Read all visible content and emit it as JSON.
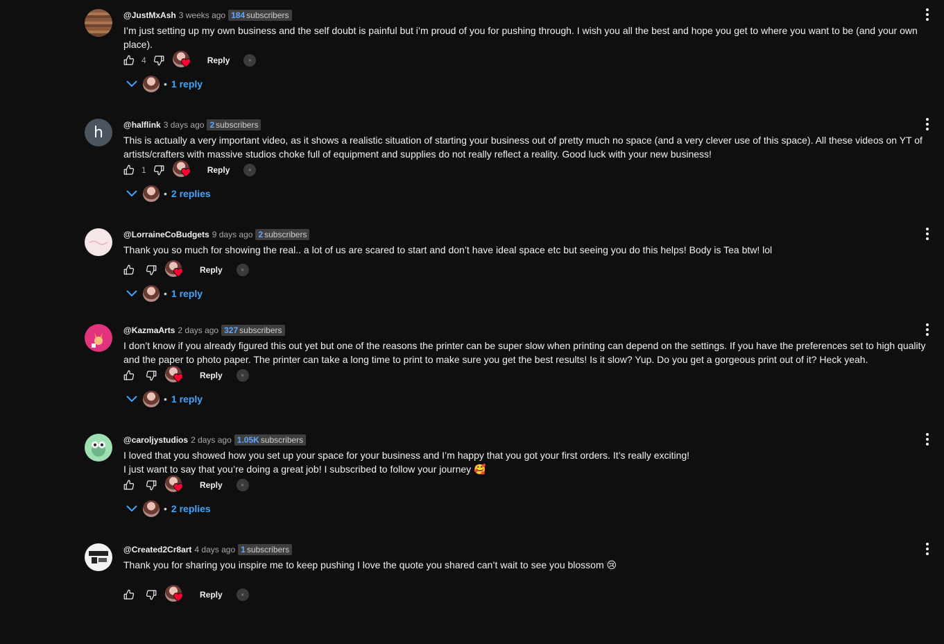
{
  "colors": {
    "background": "#0f0f0f",
    "text": "#f1f1f1",
    "muted": "#aaaaaa",
    "link_blue": "#3ea6ff",
    "badge_bg": "#3f3f3f",
    "heart_red": "#ff0033"
  },
  "comments": [
    {
      "author": "@JustMxAsh",
      "time": "3 weeks ago",
      "subs_count": "184",
      "subs_label": "subscribers",
      "text": "I’m just setting up my own business and the self doubt is painful but i’m proud of you for pushing through. I wish you all the best and hope you get to where you want to be (and your own place).",
      "likes": "4",
      "reply_label": "Reply",
      "replies_label": "1 reply",
      "avatar_type": "wood"
    },
    {
      "author": "@halflink",
      "time": "3 days ago",
      "subs_count": "2",
      "subs_label": "subscribers",
      "text": "This is actually a very important video, as it shows a realistic situation of starting your business out of pretty much no space (and a very clever use of this space). All these videos on YT of artists/crafters with massive studios choke full of equipment and supplies do not really reflect a reality. Good luck with your new business!",
      "likes": "1",
      "reply_label": "Reply",
      "replies_label": "2 replies",
      "avatar_letter": "h",
      "avatar_type": "letter"
    },
    {
      "author": "@LorraineCoBudgets",
      "time": "9 days ago",
      "subs_count": "2",
      "subs_label": "subscribers",
      "text": "Thank you so much for showing the real.. a lot of us are scared to start and don’t have ideal space etc but seeing you do this helps! Body is Tea btw! lol",
      "likes": "",
      "reply_label": "Reply",
      "replies_label": "1 reply",
      "avatar_type": "pink"
    },
    {
      "author": "@KazmaArts",
      "time": "2 days ago",
      "subs_count": "327",
      "subs_label": "subscribers",
      "text": "I don’t know if you already figured this out yet but one of the reasons  the printer can be super slow when printing can depend on the settings. If you have the preferences set to high quality and the paper to photo paper. The printer can take a long time to print to make sure you get the best results! Is it slow? Yup. Do you get a gorgeous print out of it? Heck yeah.",
      "likes": "",
      "reply_label": "Reply",
      "replies_label": "1 reply",
      "avatar_type": "fox"
    },
    {
      "author": "@caroljystudios",
      "time": "2 days ago",
      "subs_count": "1.05K",
      "subs_label": "subscribers",
      "text": "I loved that you showed how you set up your space for your business and I’m happy that you got your first orders. It’s really exciting!\nI just want to say that you’re doing a great job! I subscribed to follow your journey 🥰",
      "likes": "",
      "reply_label": "Reply",
      "replies_label": "2 replies",
      "avatar_type": "frog"
    },
    {
      "author": "@Created2Cr8art",
      "time": "4 days ago",
      "subs_count": "1",
      "subs_label": "subscribers",
      "text": "Thank you for sharing you inspire me to keep pushing I love the quote you shared can’t wait to see you blossom 😢",
      "likes": "",
      "reply_label": "Reply",
      "replies_label": "",
      "avatar_type": "created"
    }
  ]
}
